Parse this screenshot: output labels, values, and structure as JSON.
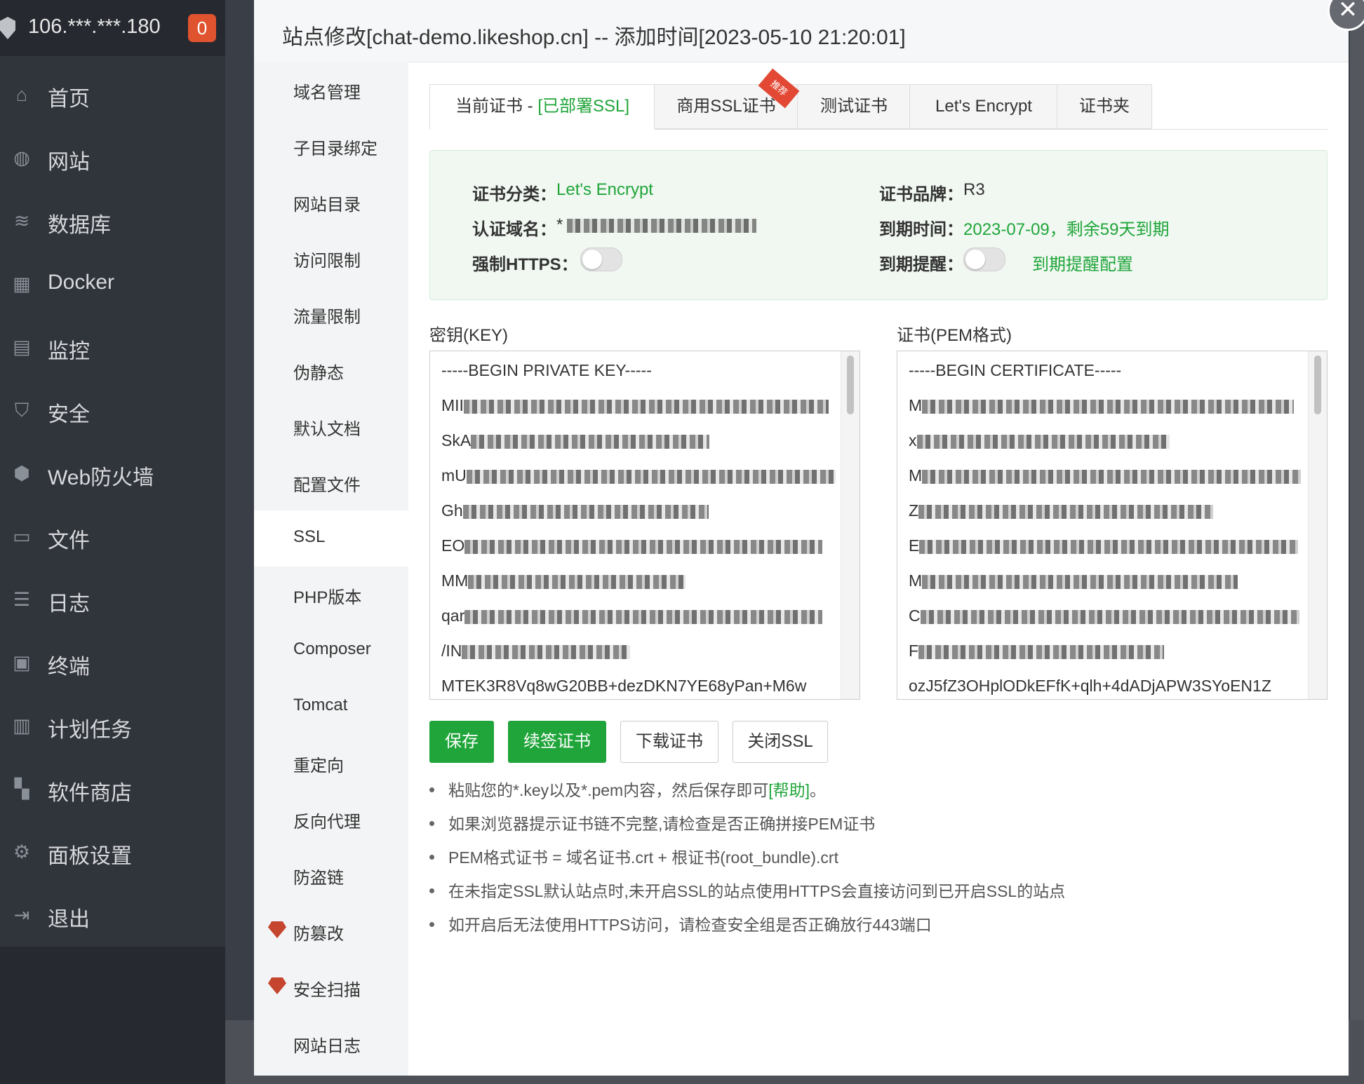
{
  "app": {
    "server_ip": "106.***.***.180",
    "notification_count": "0"
  },
  "sidebar": {
    "items": [
      {
        "label": "首页",
        "icon": "home-icon"
      },
      {
        "label": "网站",
        "icon": "globe-icon"
      },
      {
        "label": "数据库",
        "icon": "database-icon"
      },
      {
        "label": "Docker",
        "icon": "docker-icon"
      },
      {
        "label": "监控",
        "icon": "monitor-icon"
      },
      {
        "label": "安全",
        "icon": "shield-icon"
      },
      {
        "label": "Web防火墙",
        "icon": "firewall-icon"
      },
      {
        "label": "文件",
        "icon": "folder-icon"
      },
      {
        "label": "日志",
        "icon": "log-icon"
      },
      {
        "label": "终端",
        "icon": "terminal-icon"
      },
      {
        "label": "计划任务",
        "icon": "calendar-icon"
      },
      {
        "label": "软件商店",
        "icon": "apps-icon"
      },
      {
        "label": "面板设置",
        "icon": "gear-icon"
      },
      {
        "label": "退出",
        "icon": "logout-icon"
      }
    ]
  },
  "modal": {
    "title": "站点修改[chat-demo.likeshop.cn] -- 添加时间[2023-05-10 21:20:01]",
    "close_icon": "close-icon"
  },
  "settings_nav": {
    "items": [
      {
        "label": "域名管理"
      },
      {
        "label": "子目录绑定"
      },
      {
        "label": "网站目录"
      },
      {
        "label": "访问限制"
      },
      {
        "label": "流量限制"
      },
      {
        "label": "伪静态"
      },
      {
        "label": "默认文档"
      },
      {
        "label": "配置文件"
      },
      {
        "label": "SSL",
        "active": true
      },
      {
        "label": "PHP版本"
      },
      {
        "label": "Composer"
      },
      {
        "label": "Tomcat"
      },
      {
        "label": "重定向"
      },
      {
        "label": "反向代理"
      },
      {
        "label": "防盗链"
      },
      {
        "label": "防篡改",
        "premium": true
      },
      {
        "label": "安全扫描",
        "premium": true
      },
      {
        "label": "网站日志"
      }
    ]
  },
  "ssl": {
    "tabs": {
      "current_prefix": "当前证书 - ",
      "current_status": "[已部署SSL]",
      "commercial": "商用SSL证书",
      "commercial_badge": "推荐",
      "test": "测试证书",
      "letsencrypt": "Let's Encrypt",
      "folder": "证书夹"
    },
    "info": {
      "category_label": "证书分类：",
      "category_value": "Let's Encrypt",
      "brand_label": "证书品牌：",
      "brand_value": "R3",
      "domain_label": "认证域名：",
      "domain_value": "*",
      "expiry_label": "到期时间：",
      "expiry_value": "2023-07-09，剩余59天到期",
      "force_https_label": "强制HTTPS：",
      "force_https_on": false,
      "reminder_label": "到期提醒：",
      "reminder_on": false,
      "reminder_config": "到期提醒配置"
    },
    "key": {
      "label": "密钥(KEY)",
      "lines": [
        "-----BEGIN PRIVATE KEY-----",
        "MII",
        "SkA",
        "mU",
        "Gh",
        "EO",
        "MM",
        "qar",
        "/IN",
        "MTEK3R8Vq8wG20BB+dezDKN7YE68yPan+M6w"
      ]
    },
    "cert": {
      "label": "证书(PEM格式)",
      "lines": [
        "-----BEGIN CERTIFICATE-----",
        "M",
        "x",
        "M",
        "Z",
        "E",
        "M",
        "C",
        "F",
        "ozJ5fZ3OHplODkEFfK+qlh+4dADjAPW3SYoEN1Z"
      ]
    },
    "buttons": {
      "save": "保存",
      "renew": "续签证书",
      "download": "下载证书",
      "close_ssl": "关闭SSL"
    },
    "tips": {
      "tip1": "粘贴您的*.key以及*.pem内容，然后保存即可",
      "tip1_link": "[帮助]",
      "tip1_end": "。",
      "tip2": "如果浏览器提示证书链不完整,请检查是否正确拼接PEM证书",
      "tip3": "PEM格式证书 = 域名证书.crt + 根证书(root_bundle).crt",
      "tip4": "在未指定SSL默认站点时,未开启SSL的站点使用HTTPS会直接访问到已开启SSL的站点",
      "tip5": "如开启后无法使用HTTPS访问，请检查安全组是否正确放行443端口"
    }
  },
  "colors": {
    "accent_green": "#20a53a",
    "sidebar_bg": "#30343b",
    "badge_red": "#e0532f"
  }
}
